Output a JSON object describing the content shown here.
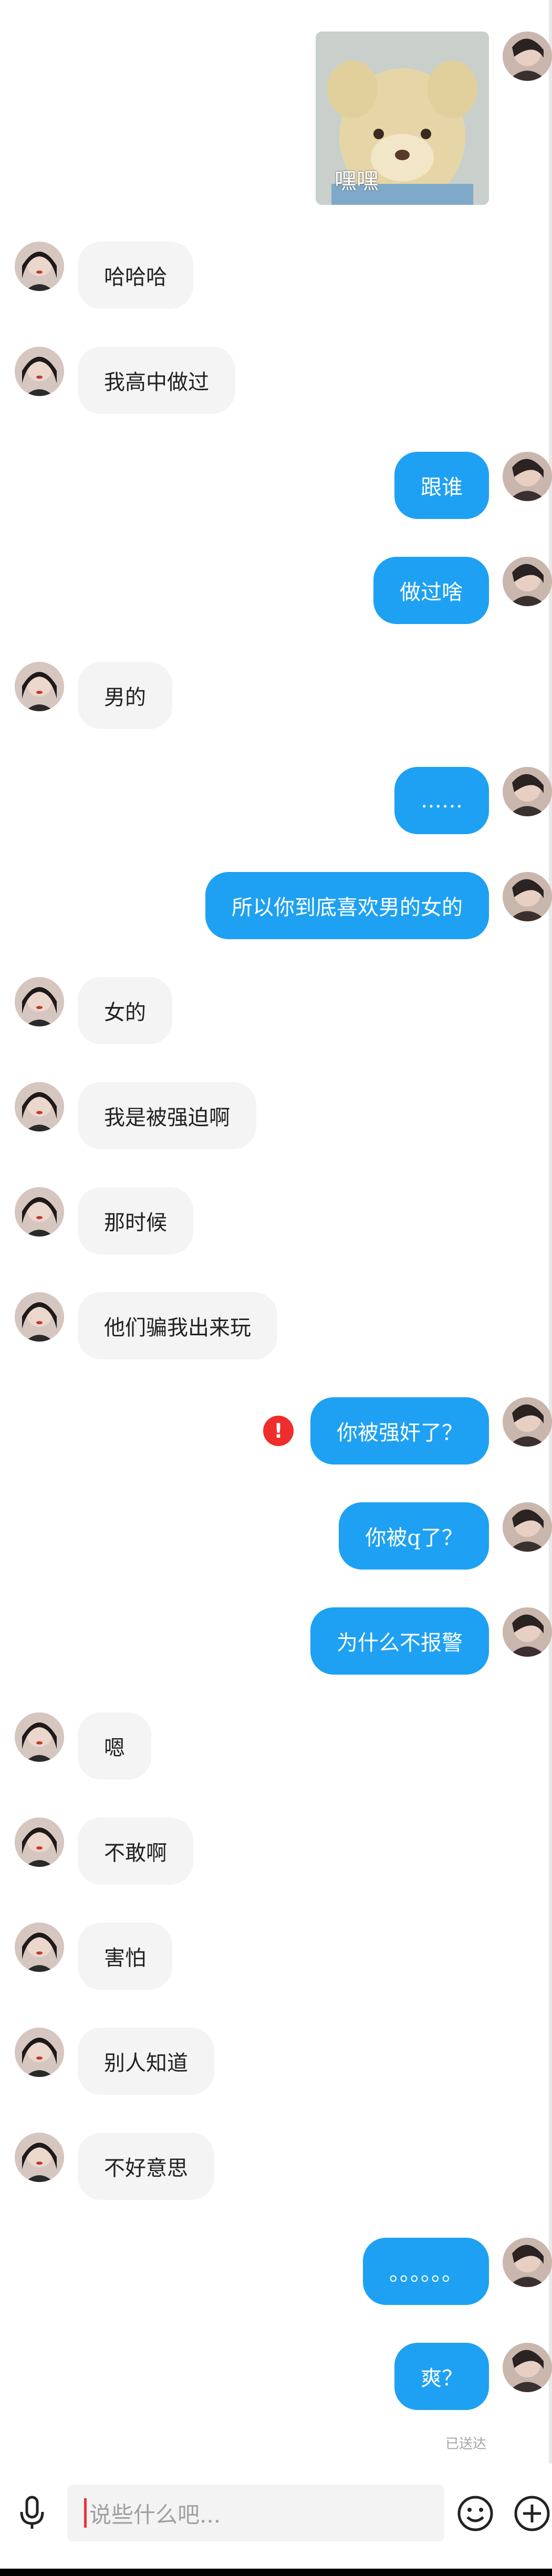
{
  "chat": {
    "sticker": {
      "caption": "嘿嘿"
    },
    "messages": [
      {
        "side": "left",
        "text": "哈哈哈"
      },
      {
        "side": "left",
        "text": "我高中做过"
      },
      {
        "side": "right",
        "text": "跟谁"
      },
      {
        "side": "right",
        "text": "做过啥"
      },
      {
        "side": "left",
        "text": "男的"
      },
      {
        "side": "right",
        "text": "……"
      },
      {
        "side": "right",
        "text": "所以你到底喜欢男的女的"
      },
      {
        "side": "left",
        "text": "女的"
      },
      {
        "side": "left",
        "text": "我是被强迫啊"
      },
      {
        "side": "left",
        "text": "那时候"
      },
      {
        "side": "left",
        "text": "他们骗我出来玩"
      },
      {
        "side": "right",
        "text": "你被强奸了？",
        "error": true
      },
      {
        "side": "right",
        "text": "你被q了？"
      },
      {
        "side": "right",
        "text": "为什么不报警"
      },
      {
        "side": "left",
        "text": "嗯"
      },
      {
        "side": "left",
        "text": "不敢啊"
      },
      {
        "side": "left",
        "text": "害怕"
      },
      {
        "side": "left",
        "text": "别人知道"
      },
      {
        "side": "left",
        "text": "不好意思"
      },
      {
        "side": "right",
        "text": "。。。。。。"
      },
      {
        "side": "right",
        "text": "爽？"
      }
    ],
    "read_status": "已送达",
    "error_mark": "!"
  },
  "input": {
    "placeholder": "说些什么吧..."
  },
  "colors": {
    "sent_bubble": "#1ea1f2",
    "received_bubble": "#f4f4f4",
    "error": "#ef2d2d"
  },
  "icons": [
    "microphone-icon",
    "emoji-icon",
    "plus-icon",
    "error-icon"
  ]
}
